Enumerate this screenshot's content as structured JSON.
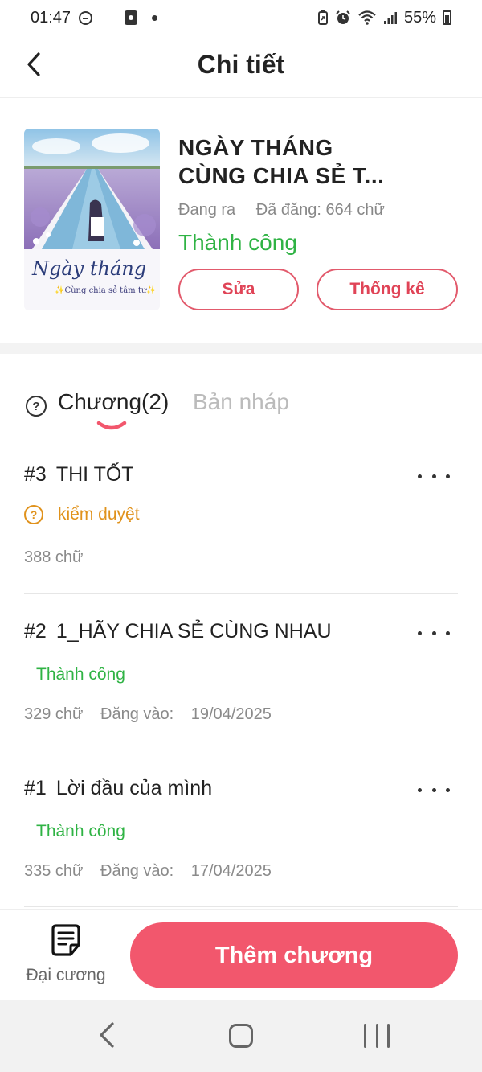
{
  "status_bar": {
    "time": "01:47",
    "battery": "55%"
  },
  "header": {
    "title": "Chi tiết"
  },
  "book": {
    "title_line1": "NGÀY THÁNG",
    "title_line2": "CÙNG CHIA SẺ T...",
    "state": "Đang ra",
    "posted": "Đã đăng: 664 chữ",
    "status": "Thành công",
    "edit_label": "Sửa",
    "stats_label": "Thống kê",
    "cover_title": "Ngày tháng",
    "cover_subtitle": "✨Cùng chia sẻ tâm tư✨"
  },
  "tabs": {
    "chapters_label": "Chương(2)",
    "drafts_label": "Bản nháp"
  },
  "chapters": [
    {
      "number": "#3",
      "title": "THI TỐT",
      "status": "kiểm duyệt",
      "words": "388 chữ"
    },
    {
      "number": "#2",
      "title": "1_HÃY CHIA SẺ CÙNG NHAU",
      "status": "Thành công",
      "words": "329 chữ",
      "posted_label": "Đăng vào:",
      "posted_date": "19/04/2025"
    },
    {
      "number": "#1",
      "title": "Lời đầu của mình",
      "status": "Thành công",
      "words": "335 chữ",
      "posted_label": "Đăng vào:",
      "posted_date": "17/04/2025"
    }
  ],
  "bottom_bar": {
    "outline_label": "Đại cương",
    "add_chapter_label": "Thêm chương"
  },
  "colors": {
    "accent": "#f2576d",
    "success": "#2fb344",
    "review": "#e0921c"
  }
}
